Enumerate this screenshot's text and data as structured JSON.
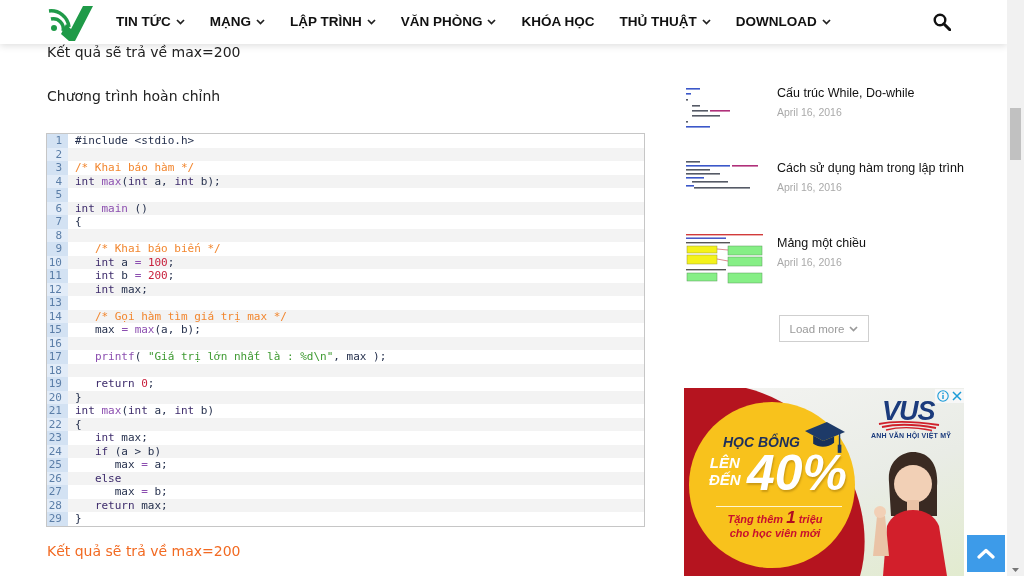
{
  "header": {
    "menu": [
      {
        "label": "TIN TỨC",
        "dropdown": true
      },
      {
        "label": "MẠNG",
        "dropdown": true
      },
      {
        "label": "LẬP TRÌNH",
        "dropdown": true
      },
      {
        "label": "VĂN PHÒNG",
        "dropdown": true
      },
      {
        "label": "KHÓA HỌC",
        "dropdown": false
      },
      {
        "label": "THỦ THUẬT",
        "dropdown": true
      },
      {
        "label": "DOWNLOAD",
        "dropdown": true
      }
    ]
  },
  "article": {
    "blocks": [
      {
        "kind": "text",
        "text": "Kết quả sẽ trả về max=200"
      },
      {
        "kind": "text",
        "text": "Chương trình hoàn chỉnh"
      },
      {
        "kind": "code",
        "lines": [
          {
            "number": "1",
            "tokens": [
              {
                "kind": "plain",
                "text": "#include <stdio.h>"
              }
            ]
          },
          {
            "number": "2"
          },
          {
            "number": "3",
            "tokens": [
              {
                "kind": "comment",
                "text": "/* Khai báo hàm */"
              }
            ]
          },
          {
            "number": "4",
            "tokens": [
              {
                "kind": "keyword",
                "text": "int "
              },
              {
                "kind": "function",
                "text": "max"
              },
              {
                "kind": "plain",
                "text": "("
              },
              {
                "kind": "keyword",
                "text": "int"
              },
              {
                "kind": "plain",
                "text": " a, "
              },
              {
                "kind": "keyword",
                "text": "int"
              },
              {
                "kind": "plain",
                "text": " b);"
              }
            ]
          },
          {
            "number": "5"
          },
          {
            "number": "6",
            "tokens": [
              {
                "kind": "keyword",
                "text": "int "
              },
              {
                "kind": "function",
                "text": "main"
              },
              {
                "kind": "plain",
                "text": " ()"
              }
            ]
          },
          {
            "number": "7",
            "tokens": [
              {
                "kind": "plain",
                "text": "{"
              }
            ]
          },
          {
            "number": "8"
          },
          {
            "number": "9",
            "tokens": [
              {
                "kind": "comment",
                "text": "   /* Khai báo biến */"
              }
            ]
          },
          {
            "number": "10",
            "tokens": [
              {
                "kind": "keyword",
                "text": "   int"
              },
              {
                "kind": "plain",
                "text": " a "
              },
              {
                "kind": "operator",
                "text": "= "
              },
              {
                "kind": "number",
                "text": "100"
              },
              {
                "kind": "plain",
                "text": ";"
              }
            ]
          },
          {
            "number": "11",
            "tokens": [
              {
                "kind": "keyword",
                "text": "   int"
              },
              {
                "kind": "plain",
                "text": " b "
              },
              {
                "kind": "operator",
                "text": "= "
              },
              {
                "kind": "number",
                "text": "200"
              },
              {
                "kind": "plain",
                "text": ";"
              }
            ]
          },
          {
            "number": "12",
            "tokens": [
              {
                "kind": "keyword",
                "text": "   int"
              },
              {
                "kind": "plain",
                "text": " max;"
              }
            ]
          },
          {
            "number": "13"
          },
          {
            "number": "14",
            "tokens": [
              {
                "kind": "comment",
                "text": "   /* Gọi hàm tìm giá trị max */"
              }
            ]
          },
          {
            "number": "15",
            "tokens": [
              {
                "kind": "plain",
                "text": "   max "
              },
              {
                "kind": "operator",
                "text": "= "
              },
              {
                "kind": "function",
                "text": "max"
              },
              {
                "kind": "plain",
                "text": "(a, b);"
              }
            ]
          },
          {
            "number": "16"
          },
          {
            "number": "17",
            "tokens": [
              {
                "kind": "function",
                "text": "   printf"
              },
              {
                "kind": "plain",
                "text": "( "
              },
              {
                "kind": "string",
                "text": "\"Giá trị lớn nhất là : %d\\n\""
              },
              {
                "kind": "plain",
                "text": ", max );"
              }
            ]
          },
          {
            "number": "18"
          },
          {
            "number": "19",
            "tokens": [
              {
                "kind": "keyword",
                "text": "   return "
              },
              {
                "kind": "number",
                "text": "0"
              },
              {
                "kind": "plain",
                "text": ";"
              }
            ]
          },
          {
            "number": "20",
            "tokens": [
              {
                "kind": "plain",
                "text": "}"
              }
            ]
          },
          {
            "number": "21",
            "tokens": [
              {
                "kind": "keyword",
                "text": "int "
              },
              {
                "kind": "function",
                "text": "max"
              },
              {
                "kind": "plain",
                "text": "("
              },
              {
                "kind": "keyword",
                "text": "int"
              },
              {
                "kind": "plain",
                "text": " a, "
              },
              {
                "kind": "keyword",
                "text": "int"
              },
              {
                "kind": "plain",
                "text": " b)"
              }
            ]
          },
          {
            "number": "22",
            "tokens": [
              {
                "kind": "plain",
                "text": "{"
              }
            ]
          },
          {
            "number": "23",
            "tokens": [
              {
                "kind": "keyword",
                "text": "   int"
              },
              {
                "kind": "plain",
                "text": " max;"
              }
            ]
          },
          {
            "number": "24",
            "tokens": [
              {
                "kind": "keyword",
                "text": "   if"
              },
              {
                "kind": "plain",
                "text": " (a > b)"
              }
            ]
          },
          {
            "number": "25",
            "tokens": [
              {
                "kind": "plain",
                "text": "      max "
              },
              {
                "kind": "operator",
                "text": "="
              },
              {
                "kind": "plain",
                "text": " a;"
              }
            ]
          },
          {
            "number": "26",
            "tokens": [
              {
                "kind": "keyword",
                "text": "   else"
              }
            ]
          },
          {
            "number": "27",
            "tokens": [
              {
                "kind": "plain",
                "text": "      max "
              },
              {
                "kind": "operator",
                "text": "="
              },
              {
                "kind": "plain",
                "text": " b;"
              }
            ]
          },
          {
            "number": "28",
            "tokens": [
              {
                "kind": "keyword",
                "text": "   return"
              },
              {
                "kind": "plain",
                "text": " max;"
              }
            ]
          },
          {
            "number": "29",
            "tokens": [
              {
                "kind": "plain",
                "text": "}"
              }
            ]
          }
        ]
      },
      {
        "kind": "highlight",
        "text": "Kết quả sẽ trả về max=200"
      }
    ]
  },
  "sidebar": {
    "posts": [
      {
        "kind": "code",
        "title": "Cấu trúc While, Do-while",
        "date": "April 16, 2016"
      },
      {
        "kind": "code",
        "title": "Cách sử dụng hàm trong lập trình",
        "date": "April 16, 2016"
      },
      {
        "kind": "diagram",
        "title": "Mảng một chiều",
        "date": "April 16, 2016"
      }
    ],
    "load_more": "Load more"
  },
  "ad": {
    "headline": "HỌC BỔNG",
    "subheadline": "LÊN ĐẾN",
    "discount": "40%",
    "offer": "Tặng thêm **1** triệu cho học viên mới",
    "brand": "VUS",
    "tagline": "ANH VĂN HỘI VIỆT MỸ"
  }
}
